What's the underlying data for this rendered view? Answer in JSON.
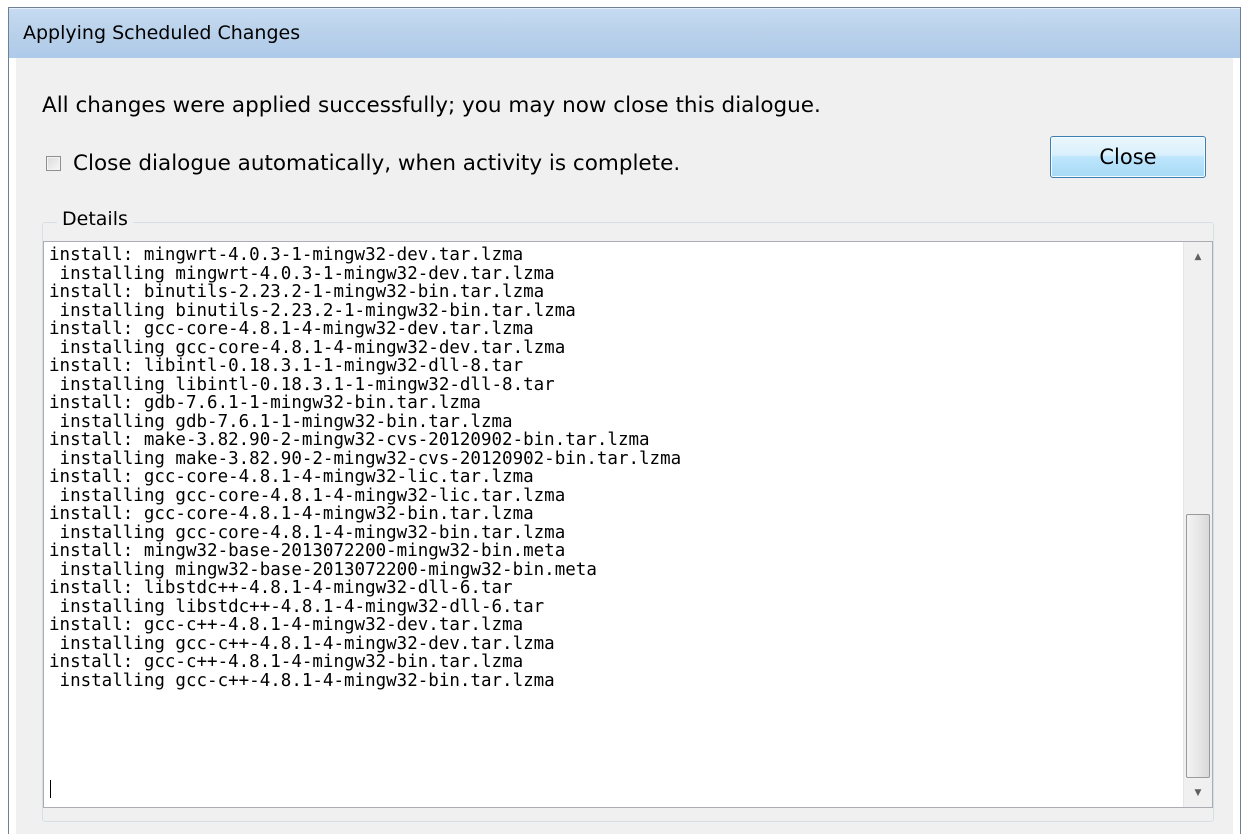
{
  "window": {
    "title": "Applying Scheduled Changes"
  },
  "message": "All changes were applied successfully; you may now close this dialogue.",
  "auto_close": {
    "label": "Close dialogue automatically, when activity is complete.",
    "checked": false
  },
  "close_button": {
    "label": "Close"
  },
  "details": {
    "legend": "Details",
    "log_lines": [
      "install: mingwrt-4.0.3-1-mingw32-dev.tar.lzma",
      " installing mingwrt-4.0.3-1-mingw32-dev.tar.lzma",
      "install: binutils-2.23.2-1-mingw32-bin.tar.lzma",
      " installing binutils-2.23.2-1-mingw32-bin.tar.lzma",
      "install: gcc-core-4.8.1-4-mingw32-dev.tar.lzma",
      " installing gcc-core-4.8.1-4-mingw32-dev.tar.lzma",
      "install: libintl-0.18.3.1-1-mingw32-dll-8.tar",
      " installing libintl-0.18.3.1-1-mingw32-dll-8.tar",
      "install: gdb-7.6.1-1-mingw32-bin.tar.lzma",
      " installing gdb-7.6.1-1-mingw32-bin.tar.lzma",
      "install: make-3.82.90-2-mingw32-cvs-20120902-bin.tar.lzma",
      " installing make-3.82.90-2-mingw32-cvs-20120902-bin.tar.lzma",
      "install: gcc-core-4.8.1-4-mingw32-lic.tar.lzma",
      " installing gcc-core-4.8.1-4-mingw32-lic.tar.lzma",
      "install: gcc-core-4.8.1-4-mingw32-bin.tar.lzma",
      " installing gcc-core-4.8.1-4-mingw32-bin.tar.lzma",
      "install: mingw32-base-2013072200-mingw32-bin.meta",
      " installing mingw32-base-2013072200-mingw32-bin.meta",
      "install: libstdc++-4.8.1-4-mingw32-dll-6.tar",
      " installing libstdc++-4.8.1-4-mingw32-dll-6.tar",
      "install: gcc-c++-4.8.1-4-mingw32-dev.tar.lzma",
      " installing gcc-c++-4.8.1-4-mingw32-dev.tar.lzma",
      "install: gcc-c++-4.8.1-4-mingw32-bin.tar.lzma",
      " installing gcc-c++-4.8.1-4-mingw32-bin.tar.lzma"
    ],
    "scroll": {
      "position": 1.0,
      "visible_fraction": 0.52
    }
  },
  "icons": {
    "scroll_up": "scroll-up-arrow-icon",
    "scroll_down": "scroll-down-arrow-icon"
  }
}
